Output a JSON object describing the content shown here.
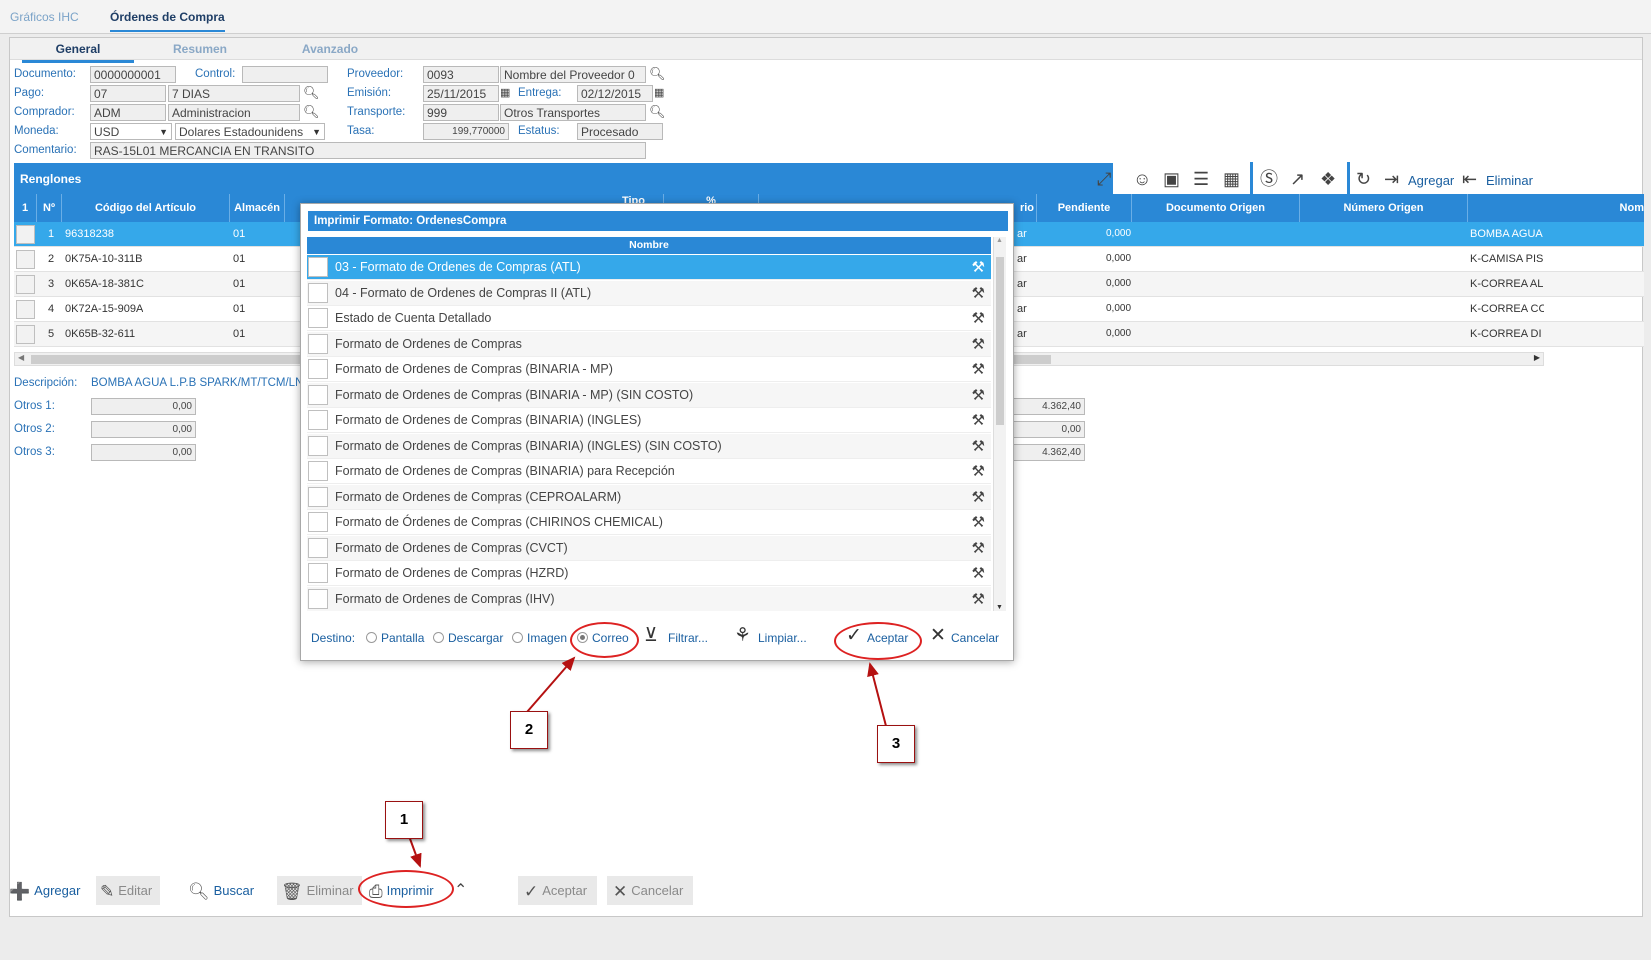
{
  "app_tabs": [
    "Gráficos IHC",
    "Órdenes de Compra"
  ],
  "sub_tabs": [
    "General",
    "Resumen",
    "Avanzado"
  ],
  "header": {
    "documento_label": "Documento:",
    "documento": "0000000001",
    "control_label": "Control:",
    "control": "",
    "proveedor_label": "Proveedor:",
    "proveedor_code": "0093",
    "proveedor_name": "Nombre del Proveedor 0",
    "pago_label": "Pago:",
    "pago_code": "07",
    "pago_desc": "7 DIAS",
    "emision_label": "Emisión:",
    "emision": "25/11/2015",
    "entrega_label": "Entrega:",
    "entrega": "02/12/2015",
    "comprador_label": "Comprador:",
    "comprador_code": "ADM",
    "comprador_name": "Administracion",
    "transporte_label": "Transporte:",
    "transporte_code": "999",
    "transporte_name": "Otros Transportes",
    "moneda_label": "Moneda:",
    "moneda": "USD",
    "moneda_desc": "Dolares Estadounidens",
    "tasa_label": "Tasa:",
    "tasa": "199,770000",
    "estatus_label": "Estatus:",
    "estatus": "Procesado",
    "comentario_label": "Comentario:",
    "comentario": "RAS-15L01  MERCANCIA EN TRANSITO"
  },
  "renglones": {
    "title": "Renglones",
    "agregar": "Agregar",
    "eliminar": "Eliminar",
    "columns": [
      "1",
      "Nº",
      "Código del Artículo",
      "Almacén",
      "Tipo",
      "%",
      "rio",
      "Pendiente",
      "Documento Origen",
      "Número Origen",
      "Nom"
    ],
    "rows": [
      {
        "n": "1",
        "codigo": "96318238",
        "almacen": "01",
        "rio": "ar",
        "pendiente": "0,000",
        "nombre": "BOMBA AGUA"
      },
      {
        "n": "2",
        "codigo": "0K75A-10-311B",
        "almacen": "01",
        "rio": "ar",
        "pendiente": "0,000",
        "nombre": "K-CAMISA PIS"
      },
      {
        "n": "3",
        "codigo": "0K65A-18-381C",
        "almacen": "01",
        "rio": "ar",
        "pendiente": "0,000",
        "nombre": "K-CORREA AL"
      },
      {
        "n": "4",
        "codigo": "0K72A-15-909A",
        "almacen": "01",
        "rio": "ar",
        "pendiente": "0,000",
        "nombre": "K-CORREA CC"
      },
      {
        "n": "5",
        "codigo": "0K65B-32-611",
        "almacen": "01",
        "rio": "ar",
        "pendiente": "0,000",
        "nombre": "K-CORREA DI"
      }
    ]
  },
  "details": {
    "descripcion_label": "Descripción:",
    "descripcion": "BOMBA AGUA L.P.B SPARK/MT/TCM/LN",
    "otros1_label": "Otros 1:",
    "otros1": "0,00",
    "otros2_label": "Otros 2:",
    "otros2": "0,00",
    "otros3_label": "Otros 3:",
    "otros3": "0,00",
    "tot1": "4.362,40",
    "tot2": "0,00",
    "tot3": "4.362,40"
  },
  "modal": {
    "title": "Imprimir Formato: OrdenesCompra",
    "column": "Nombre",
    "items": [
      "03 - Formato de Ordenes de Compras (ATL)",
      "04 - Formato de Ordenes de Compras II (ATL)",
      "Estado de Cuenta Detallado",
      "Formato de Ordenes de Compras",
      "Formato de Ordenes de Compras (BINARIA - MP)",
      "Formato de Ordenes de Compras (BINARIA - MP) (SIN COSTO)",
      "Formato de Ordenes de Compras (BINARIA) (INGLES)",
      "Formato de Ordenes de Compras (BINARIA) (INGLES) (SIN COSTO)",
      "Formato de Ordenes de Compras (BINARIA) para Recepción",
      "Formato de Ordenes de Compras (CEPROALARM)",
      "Formato de Órdenes de Compras (CHIRINOS CHEMICAL)",
      "Formato de Ordenes de Compras (CVCT)",
      "Formato de Ordenes de Compras (HZRD)",
      "Formato de Ordenes de Compras (IHV)"
    ],
    "destino_label": "Destino:",
    "destinos": [
      "Pantalla",
      "Descargar",
      "Imagen",
      "Correo"
    ],
    "selected_destino": "Correo",
    "filtrar": "Filtrar...",
    "limpiar": "Limpiar...",
    "aceptar": "Aceptar",
    "cancelar": "Cancelar"
  },
  "bottom_toolbar": {
    "agregar": "Agregar",
    "editar": "Editar",
    "buscar": "Buscar",
    "eliminar": "Eliminar",
    "imprimir": "Imprimir",
    "aceptar": "Aceptar",
    "cancelar": "Cancelar"
  },
  "callouts": [
    "1",
    "2",
    "3"
  ],
  "colors": {
    "accent": "#2a88d6",
    "selection": "#35a8ea",
    "annotation": "#d22222"
  }
}
